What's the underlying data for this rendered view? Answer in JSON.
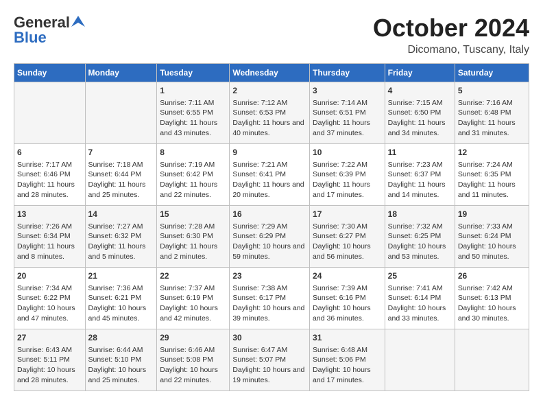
{
  "header": {
    "logo_general": "General",
    "logo_blue": "Blue",
    "month_title": "October 2024",
    "location": "Dicomano, Tuscany, Italy"
  },
  "columns": [
    "Sunday",
    "Monday",
    "Tuesday",
    "Wednesday",
    "Thursday",
    "Friday",
    "Saturday"
  ],
  "weeks": [
    [
      {
        "day": "",
        "content": ""
      },
      {
        "day": "",
        "content": ""
      },
      {
        "day": "1",
        "content": "Sunrise: 7:11 AM\nSunset: 6:55 PM\nDaylight: 11 hours and 43 minutes."
      },
      {
        "day": "2",
        "content": "Sunrise: 7:12 AM\nSunset: 6:53 PM\nDaylight: 11 hours and 40 minutes."
      },
      {
        "day": "3",
        "content": "Sunrise: 7:14 AM\nSunset: 6:51 PM\nDaylight: 11 hours and 37 minutes."
      },
      {
        "day": "4",
        "content": "Sunrise: 7:15 AM\nSunset: 6:50 PM\nDaylight: 11 hours and 34 minutes."
      },
      {
        "day": "5",
        "content": "Sunrise: 7:16 AM\nSunset: 6:48 PM\nDaylight: 11 hours and 31 minutes."
      }
    ],
    [
      {
        "day": "6",
        "content": "Sunrise: 7:17 AM\nSunset: 6:46 PM\nDaylight: 11 hours and 28 minutes."
      },
      {
        "day": "7",
        "content": "Sunrise: 7:18 AM\nSunset: 6:44 PM\nDaylight: 11 hours and 25 minutes."
      },
      {
        "day": "8",
        "content": "Sunrise: 7:19 AM\nSunset: 6:42 PM\nDaylight: 11 hours and 22 minutes."
      },
      {
        "day": "9",
        "content": "Sunrise: 7:21 AM\nSunset: 6:41 PM\nDaylight: 11 hours and 20 minutes."
      },
      {
        "day": "10",
        "content": "Sunrise: 7:22 AM\nSunset: 6:39 PM\nDaylight: 11 hours and 17 minutes."
      },
      {
        "day": "11",
        "content": "Sunrise: 7:23 AM\nSunset: 6:37 PM\nDaylight: 11 hours and 14 minutes."
      },
      {
        "day": "12",
        "content": "Sunrise: 7:24 AM\nSunset: 6:35 PM\nDaylight: 11 hours and 11 minutes."
      }
    ],
    [
      {
        "day": "13",
        "content": "Sunrise: 7:26 AM\nSunset: 6:34 PM\nDaylight: 11 hours and 8 minutes."
      },
      {
        "day": "14",
        "content": "Sunrise: 7:27 AM\nSunset: 6:32 PM\nDaylight: 11 hours and 5 minutes."
      },
      {
        "day": "15",
        "content": "Sunrise: 7:28 AM\nSunset: 6:30 PM\nDaylight: 11 hours and 2 minutes."
      },
      {
        "day": "16",
        "content": "Sunrise: 7:29 AM\nSunset: 6:29 PM\nDaylight: 10 hours and 59 minutes."
      },
      {
        "day": "17",
        "content": "Sunrise: 7:30 AM\nSunset: 6:27 PM\nDaylight: 10 hours and 56 minutes."
      },
      {
        "day": "18",
        "content": "Sunrise: 7:32 AM\nSunset: 6:25 PM\nDaylight: 10 hours and 53 minutes."
      },
      {
        "day": "19",
        "content": "Sunrise: 7:33 AM\nSunset: 6:24 PM\nDaylight: 10 hours and 50 minutes."
      }
    ],
    [
      {
        "day": "20",
        "content": "Sunrise: 7:34 AM\nSunset: 6:22 PM\nDaylight: 10 hours and 47 minutes."
      },
      {
        "day": "21",
        "content": "Sunrise: 7:36 AM\nSunset: 6:21 PM\nDaylight: 10 hours and 45 minutes."
      },
      {
        "day": "22",
        "content": "Sunrise: 7:37 AM\nSunset: 6:19 PM\nDaylight: 10 hours and 42 minutes."
      },
      {
        "day": "23",
        "content": "Sunrise: 7:38 AM\nSunset: 6:17 PM\nDaylight: 10 hours and 39 minutes."
      },
      {
        "day": "24",
        "content": "Sunrise: 7:39 AM\nSunset: 6:16 PM\nDaylight: 10 hours and 36 minutes."
      },
      {
        "day": "25",
        "content": "Sunrise: 7:41 AM\nSunset: 6:14 PM\nDaylight: 10 hours and 33 minutes."
      },
      {
        "day": "26",
        "content": "Sunrise: 7:42 AM\nSunset: 6:13 PM\nDaylight: 10 hours and 30 minutes."
      }
    ],
    [
      {
        "day": "27",
        "content": "Sunrise: 6:43 AM\nSunset: 5:11 PM\nDaylight: 10 hours and 28 minutes."
      },
      {
        "day": "28",
        "content": "Sunrise: 6:44 AM\nSunset: 5:10 PM\nDaylight: 10 hours and 25 minutes."
      },
      {
        "day": "29",
        "content": "Sunrise: 6:46 AM\nSunset: 5:08 PM\nDaylight: 10 hours and 22 minutes."
      },
      {
        "day": "30",
        "content": "Sunrise: 6:47 AM\nSunset: 5:07 PM\nDaylight: 10 hours and 19 minutes."
      },
      {
        "day": "31",
        "content": "Sunrise: 6:48 AM\nSunset: 5:06 PM\nDaylight: 10 hours and 17 minutes."
      },
      {
        "day": "",
        "content": ""
      },
      {
        "day": "",
        "content": ""
      }
    ]
  ]
}
